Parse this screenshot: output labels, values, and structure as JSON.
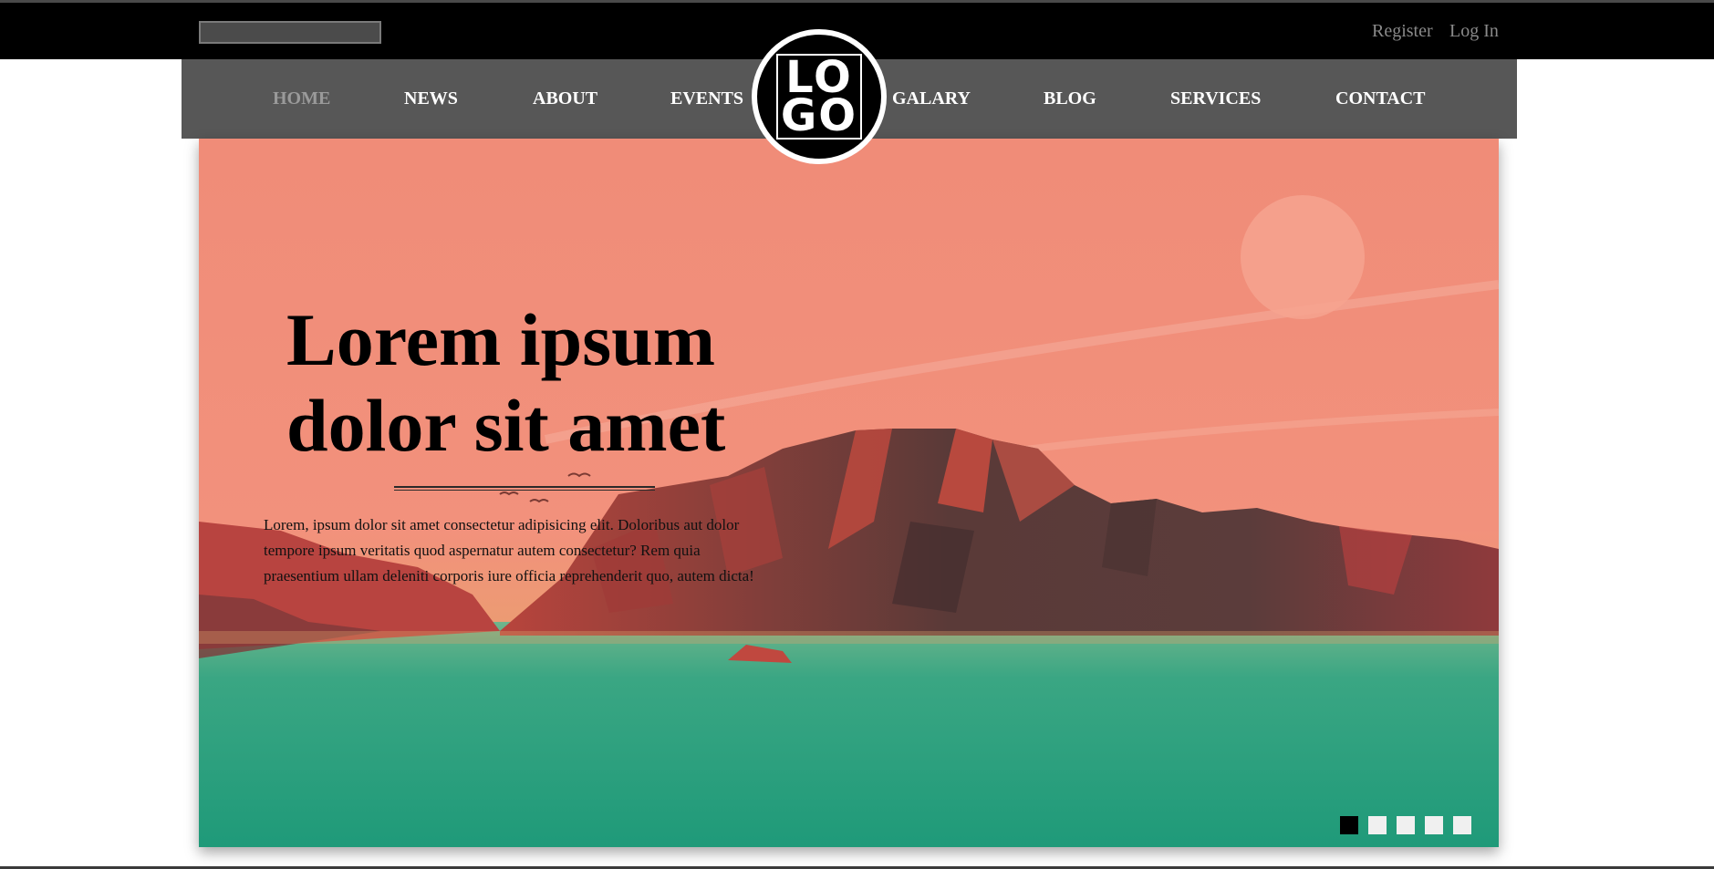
{
  "topbar": {
    "search_placeholder": "",
    "register": "Register",
    "login": "Log In"
  },
  "nav": {
    "items": [
      {
        "label": "HOME",
        "active": true
      },
      {
        "label": "NEWS"
      },
      {
        "label": "ABOUT"
      },
      {
        "label": "EVENTS"
      },
      {
        "label": "GALARY"
      },
      {
        "label": "BLOG"
      },
      {
        "label": "SERVICES"
      },
      {
        "label": "CONTACT"
      }
    ]
  },
  "logo": {
    "line1": "LO",
    "line2": "GO"
  },
  "hero": {
    "title_line1": "Lorem ipsum",
    "title_line2": "dolor sit amet",
    "body": "Lorem, ipsum dolor sit amet consectetur adipisicing elit. Doloribus aut dolor tempore ipsum veritatis quod aspernatur autem consectetur? Rem quia praesentium ullam deleniti corporis iure officia reprehenderit quo, autem dicta!",
    "slides_total": 5,
    "slide_active": 1
  },
  "colors": {
    "topbar": "#000000",
    "navbar": "#575757",
    "nav_active": "#9a9a9a",
    "sky": "#f28e7c",
    "water": "#2a9e7f"
  }
}
